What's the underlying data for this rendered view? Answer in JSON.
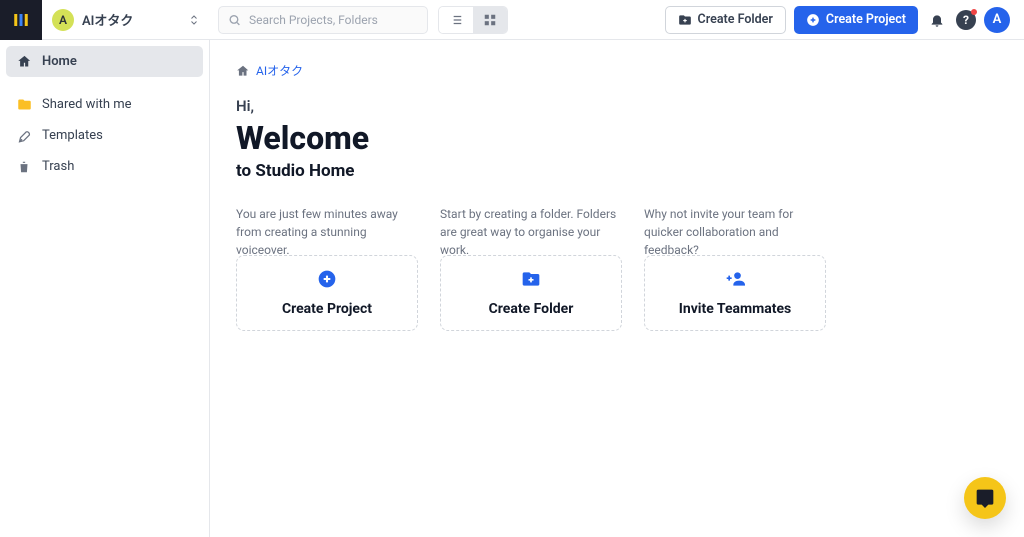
{
  "workspace": {
    "avatar": "A",
    "name": "AIオタク"
  },
  "search": {
    "placeholder": "Search Projects, Folders"
  },
  "header": {
    "create_folder": "Create Folder",
    "create_project": "Create Project"
  },
  "user": {
    "avatar": "A",
    "help": "?"
  },
  "sidebar": {
    "home": "Home",
    "shared": "Shared with me",
    "templates": "Templates",
    "trash": "Trash"
  },
  "breadcrumb": {
    "root": "AIオタク"
  },
  "hero": {
    "hi": "Hi,",
    "welcome": "Welcome",
    "subtitle": "to Studio Home"
  },
  "cards": {
    "project": {
      "desc": "You are just few minutes away from creating a stunning voiceover.",
      "label": "Create Project"
    },
    "folder": {
      "desc": "Start by creating a folder. Folders are great way to organise your work.",
      "label": "Create Folder"
    },
    "invite": {
      "desc": "Why not invite your team for quicker collaboration and feedback?",
      "label": "Invite Teammates"
    }
  }
}
